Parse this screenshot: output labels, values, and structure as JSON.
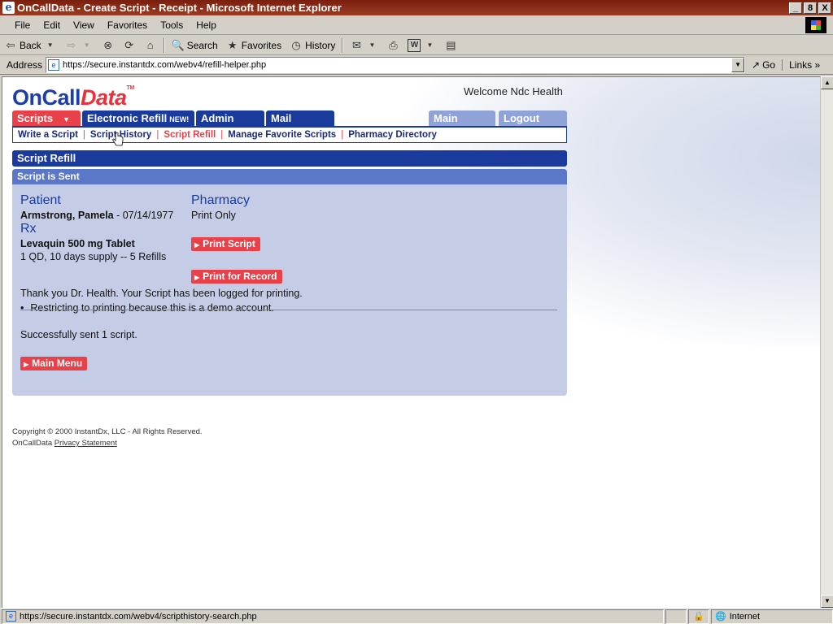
{
  "window": {
    "title": "OnCallData - Create Script - Receipt - Microsoft Internet Explorer",
    "buttons": [
      "_",
      "8",
      "X"
    ]
  },
  "menubar": {
    "items": [
      "File",
      "Edit",
      "View",
      "Favorites",
      "Tools",
      "Help"
    ]
  },
  "toolbar": {
    "back": "Back",
    "search": "Search",
    "favorites": "Favorites",
    "history": "History"
  },
  "address": {
    "label": "Address",
    "url": "https://secure.instantdx.com/webv4/refill-helper.php",
    "go": "Go",
    "links": "Links »"
  },
  "page": {
    "logo_a": "OnCall",
    "logo_b": "Data",
    "logo_tm": "TM",
    "welcome": "Welcome Ndc Health",
    "tabs": {
      "scripts": "Scripts",
      "eref": "Electronic Refill",
      "eref_new": "NEW!",
      "admin": "Admin",
      "mail": "Mail",
      "main": "Main",
      "logout": "Logout"
    },
    "subnav": {
      "write": "Write a Script",
      "history": "Script History",
      "refill": "Script Refill",
      "favorites": "Manage Favorite Scripts",
      "pharmacy": "Pharmacy Directory"
    },
    "section_title": "Script Refill",
    "panel_title": "Script is Sent",
    "patient_heading": "Patient",
    "patient_name": "Armstrong, Pamela",
    "patient_dob": " - 07/14/1977",
    "rx_heading": "Rx",
    "rx_drug": "Levaquin 500 mg Tablet",
    "rx_sig": "1 QD, 10 days supply -- 5 Refills",
    "pharmacy_heading": "Pharmacy",
    "pharmacy_value": "Print Only",
    "btn_print_script": "Print Script",
    "btn_print_record": "Print for Record",
    "thanks": "Thank you Dr. Health. Your Script has been logged for printing.",
    "bullet": "Restricting to printing because this is a demo account.",
    "success": "Successfully sent 1 script.",
    "btn_main_menu": "Main Menu",
    "footer_copyright": "Copyright © 2000 InstantDx, LLC - All Rights Reserved.",
    "footer_brand": "OnCallData",
    "footer_privacy": "Privacy Statement"
  },
  "statusbar": {
    "url": "https://secure.instantdx.com/webv4/scripthistory-search.php",
    "zone": "Internet"
  },
  "colors": {
    "brand_blue": "#1a3a9c",
    "brand_red": "#e8414a",
    "panel_bg": "#c5cde6"
  }
}
